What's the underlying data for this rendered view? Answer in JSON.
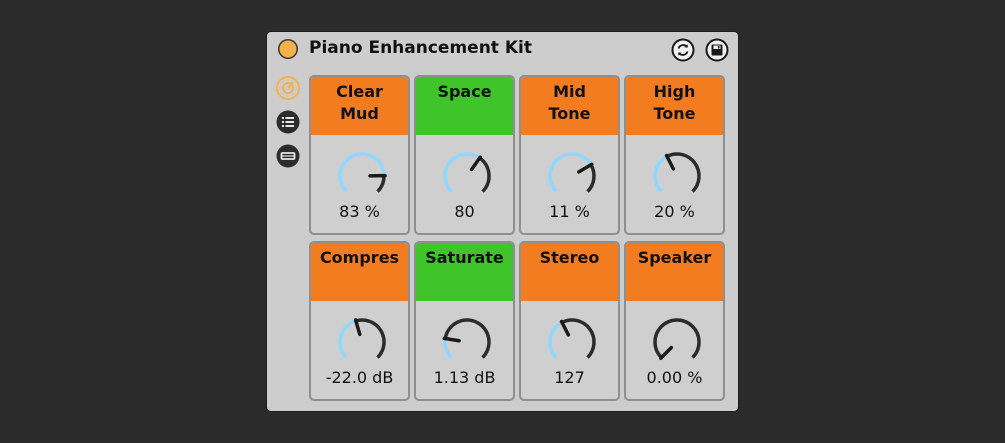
{
  "device": {
    "title": "Piano Enhancement Kit"
  },
  "colors": {
    "power": "#f5b24c",
    "orange": "#f47c20",
    "green": "#3fc52a",
    "knob_active": "#8fd8ff",
    "knob_track": "#2c2c2c"
  },
  "icons": {
    "header": [
      "swap-icon",
      "save-icon"
    ],
    "side": [
      "macro-icon",
      "list-icon",
      "panel-icon"
    ]
  },
  "macros": [
    {
      "name": "Clear\nMud",
      "value": "83 %",
      "norm": 0.83,
      "color": "orange"
    },
    {
      "name": "Space",
      "value": "80",
      "norm": 0.63,
      "color": "green"
    },
    {
      "name": "Mid\nTone",
      "value": "11 %",
      "norm": 0.72,
      "color": "orange"
    },
    {
      "name": "High\nTone",
      "value": "20 %",
      "norm": 0.4,
      "color": "orange"
    },
    {
      "name": "Compres",
      "value": "-22.0 dB",
      "norm": 0.44,
      "color": "orange"
    },
    {
      "name": "Saturate",
      "value": "1.13 dB",
      "norm": 0.2,
      "color": "green"
    },
    {
      "name": "Stereo",
      "value": "127",
      "norm": 0.4,
      "color": "orange"
    },
    {
      "name": "Speaker",
      "value": "0.00 %",
      "norm": 0.0,
      "color": "orange"
    }
  ]
}
